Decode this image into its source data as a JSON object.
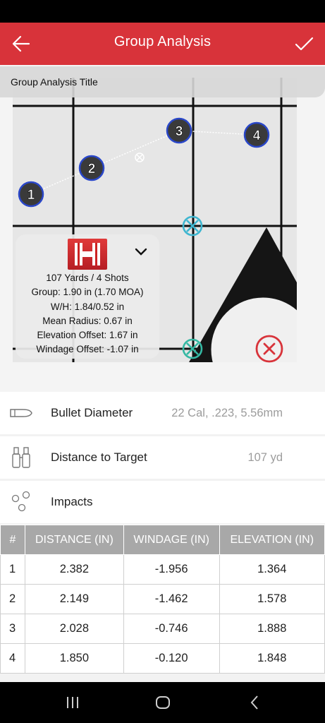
{
  "header": {
    "title": "Group Analysis",
    "back_icon": "arrow-left-icon",
    "confirm_icon": "check-icon"
  },
  "target": {
    "title_label": "Group Analysis Title",
    "impact_labels": [
      "1",
      "2",
      "3",
      "4"
    ],
    "stats": {
      "summary": "107 Yards / 4 Shots",
      "group": "Group: 1.90 in (1.70 MOA)",
      "wh": "W/H: 1.84/0.52 in",
      "mean_radius": "Mean Radius: 0.67 in",
      "elevation_offset": "Elevation Offset: 1.67 in",
      "windage_offset": "Windage Offset: -1.07 in"
    }
  },
  "settings": {
    "bullet_label": "Bullet Diameter",
    "bullet_value": "22 Cal, .223, 5.56mm",
    "distance_label": "Distance to Target",
    "distance_value": "107 yd",
    "impacts_label": "Impacts"
  },
  "table": {
    "headers": [
      "#",
      "DISTANCE (IN)",
      "WINDAGE (IN)",
      "ELEVATION (IN)"
    ],
    "rows": [
      [
        "1",
        "2.382",
        "-1.956",
        "1.364"
      ],
      [
        "2",
        "2.149",
        "-1.462",
        "1.578"
      ],
      [
        "3",
        "2.028",
        "-0.746",
        "1.888"
      ],
      [
        "4",
        "1.850",
        "-0.120",
        "1.848"
      ]
    ]
  },
  "colors": {
    "brand": "#d8333a",
    "header_gray": "#a8a8a8",
    "impact_ring": "#2a47c9",
    "crosshair": "#3fb6d0"
  }
}
